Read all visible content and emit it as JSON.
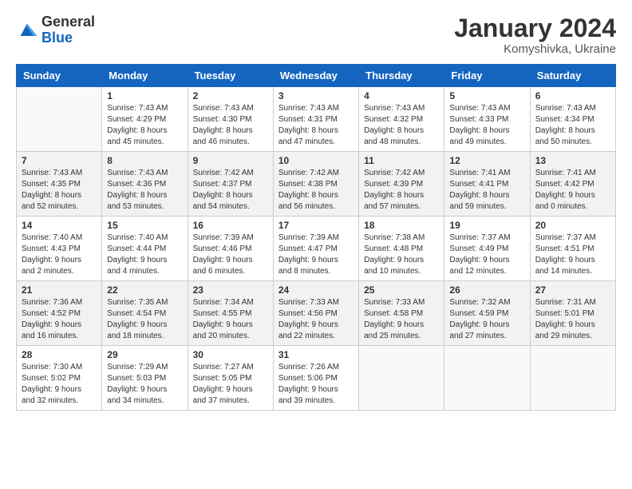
{
  "logo": {
    "general": "General",
    "blue": "Blue"
  },
  "title": "January 2024",
  "subtitle": "Komyshivka, Ukraine",
  "days_of_week": [
    "Sunday",
    "Monday",
    "Tuesday",
    "Wednesday",
    "Thursday",
    "Friday",
    "Saturday"
  ],
  "weeks": [
    [
      {
        "num": "",
        "sunrise": "",
        "sunset": "",
        "daylight": "",
        "empty": true
      },
      {
        "num": "1",
        "sunrise": "Sunrise: 7:43 AM",
        "sunset": "Sunset: 4:29 PM",
        "daylight": "Daylight: 8 hours and 45 minutes."
      },
      {
        "num": "2",
        "sunrise": "Sunrise: 7:43 AM",
        "sunset": "Sunset: 4:30 PM",
        "daylight": "Daylight: 8 hours and 46 minutes."
      },
      {
        "num": "3",
        "sunrise": "Sunrise: 7:43 AM",
        "sunset": "Sunset: 4:31 PM",
        "daylight": "Daylight: 8 hours and 47 minutes."
      },
      {
        "num": "4",
        "sunrise": "Sunrise: 7:43 AM",
        "sunset": "Sunset: 4:32 PM",
        "daylight": "Daylight: 8 hours and 48 minutes."
      },
      {
        "num": "5",
        "sunrise": "Sunrise: 7:43 AM",
        "sunset": "Sunset: 4:33 PM",
        "daylight": "Daylight: 8 hours and 49 minutes."
      },
      {
        "num": "6",
        "sunrise": "Sunrise: 7:43 AM",
        "sunset": "Sunset: 4:34 PM",
        "daylight": "Daylight: 8 hours and 50 minutes."
      }
    ],
    [
      {
        "num": "7",
        "sunrise": "Sunrise: 7:43 AM",
        "sunset": "Sunset: 4:35 PM",
        "daylight": "Daylight: 8 hours and 52 minutes."
      },
      {
        "num": "8",
        "sunrise": "Sunrise: 7:43 AM",
        "sunset": "Sunset: 4:36 PM",
        "daylight": "Daylight: 8 hours and 53 minutes."
      },
      {
        "num": "9",
        "sunrise": "Sunrise: 7:42 AM",
        "sunset": "Sunset: 4:37 PM",
        "daylight": "Daylight: 8 hours and 54 minutes."
      },
      {
        "num": "10",
        "sunrise": "Sunrise: 7:42 AM",
        "sunset": "Sunset: 4:38 PM",
        "daylight": "Daylight: 8 hours and 56 minutes."
      },
      {
        "num": "11",
        "sunrise": "Sunrise: 7:42 AM",
        "sunset": "Sunset: 4:39 PM",
        "daylight": "Daylight: 8 hours and 57 minutes."
      },
      {
        "num": "12",
        "sunrise": "Sunrise: 7:41 AM",
        "sunset": "Sunset: 4:41 PM",
        "daylight": "Daylight: 8 hours and 59 minutes."
      },
      {
        "num": "13",
        "sunrise": "Sunrise: 7:41 AM",
        "sunset": "Sunset: 4:42 PM",
        "daylight": "Daylight: 9 hours and 0 minutes."
      }
    ],
    [
      {
        "num": "14",
        "sunrise": "Sunrise: 7:40 AM",
        "sunset": "Sunset: 4:43 PM",
        "daylight": "Daylight: 9 hours and 2 minutes."
      },
      {
        "num": "15",
        "sunrise": "Sunrise: 7:40 AM",
        "sunset": "Sunset: 4:44 PM",
        "daylight": "Daylight: 9 hours and 4 minutes."
      },
      {
        "num": "16",
        "sunrise": "Sunrise: 7:39 AM",
        "sunset": "Sunset: 4:46 PM",
        "daylight": "Daylight: 9 hours and 6 minutes."
      },
      {
        "num": "17",
        "sunrise": "Sunrise: 7:39 AM",
        "sunset": "Sunset: 4:47 PM",
        "daylight": "Daylight: 9 hours and 8 minutes."
      },
      {
        "num": "18",
        "sunrise": "Sunrise: 7:38 AM",
        "sunset": "Sunset: 4:48 PM",
        "daylight": "Daylight: 9 hours and 10 minutes."
      },
      {
        "num": "19",
        "sunrise": "Sunrise: 7:37 AM",
        "sunset": "Sunset: 4:49 PM",
        "daylight": "Daylight: 9 hours and 12 minutes."
      },
      {
        "num": "20",
        "sunrise": "Sunrise: 7:37 AM",
        "sunset": "Sunset: 4:51 PM",
        "daylight": "Daylight: 9 hours and 14 minutes."
      }
    ],
    [
      {
        "num": "21",
        "sunrise": "Sunrise: 7:36 AM",
        "sunset": "Sunset: 4:52 PM",
        "daylight": "Daylight: 9 hours and 16 minutes."
      },
      {
        "num": "22",
        "sunrise": "Sunrise: 7:35 AM",
        "sunset": "Sunset: 4:54 PM",
        "daylight": "Daylight: 9 hours and 18 minutes."
      },
      {
        "num": "23",
        "sunrise": "Sunrise: 7:34 AM",
        "sunset": "Sunset: 4:55 PM",
        "daylight": "Daylight: 9 hours and 20 minutes."
      },
      {
        "num": "24",
        "sunrise": "Sunrise: 7:33 AM",
        "sunset": "Sunset: 4:56 PM",
        "daylight": "Daylight: 9 hours and 22 minutes."
      },
      {
        "num": "25",
        "sunrise": "Sunrise: 7:33 AM",
        "sunset": "Sunset: 4:58 PM",
        "daylight": "Daylight: 9 hours and 25 minutes."
      },
      {
        "num": "26",
        "sunrise": "Sunrise: 7:32 AM",
        "sunset": "Sunset: 4:59 PM",
        "daylight": "Daylight: 9 hours and 27 minutes."
      },
      {
        "num": "27",
        "sunrise": "Sunrise: 7:31 AM",
        "sunset": "Sunset: 5:01 PM",
        "daylight": "Daylight: 9 hours and 29 minutes."
      }
    ],
    [
      {
        "num": "28",
        "sunrise": "Sunrise: 7:30 AM",
        "sunset": "Sunset: 5:02 PM",
        "daylight": "Daylight: 9 hours and 32 minutes."
      },
      {
        "num": "29",
        "sunrise": "Sunrise: 7:29 AM",
        "sunset": "Sunset: 5:03 PM",
        "daylight": "Daylight: 9 hours and 34 minutes."
      },
      {
        "num": "30",
        "sunrise": "Sunrise: 7:27 AM",
        "sunset": "Sunset: 5:05 PM",
        "daylight": "Daylight: 9 hours and 37 minutes."
      },
      {
        "num": "31",
        "sunrise": "Sunrise: 7:26 AM",
        "sunset": "Sunset: 5:06 PM",
        "daylight": "Daylight: 9 hours and 39 minutes."
      },
      {
        "num": "",
        "sunrise": "",
        "sunset": "",
        "daylight": "",
        "empty": true
      },
      {
        "num": "",
        "sunrise": "",
        "sunset": "",
        "daylight": "",
        "empty": true
      },
      {
        "num": "",
        "sunrise": "",
        "sunset": "",
        "daylight": "",
        "empty": true
      }
    ]
  ]
}
